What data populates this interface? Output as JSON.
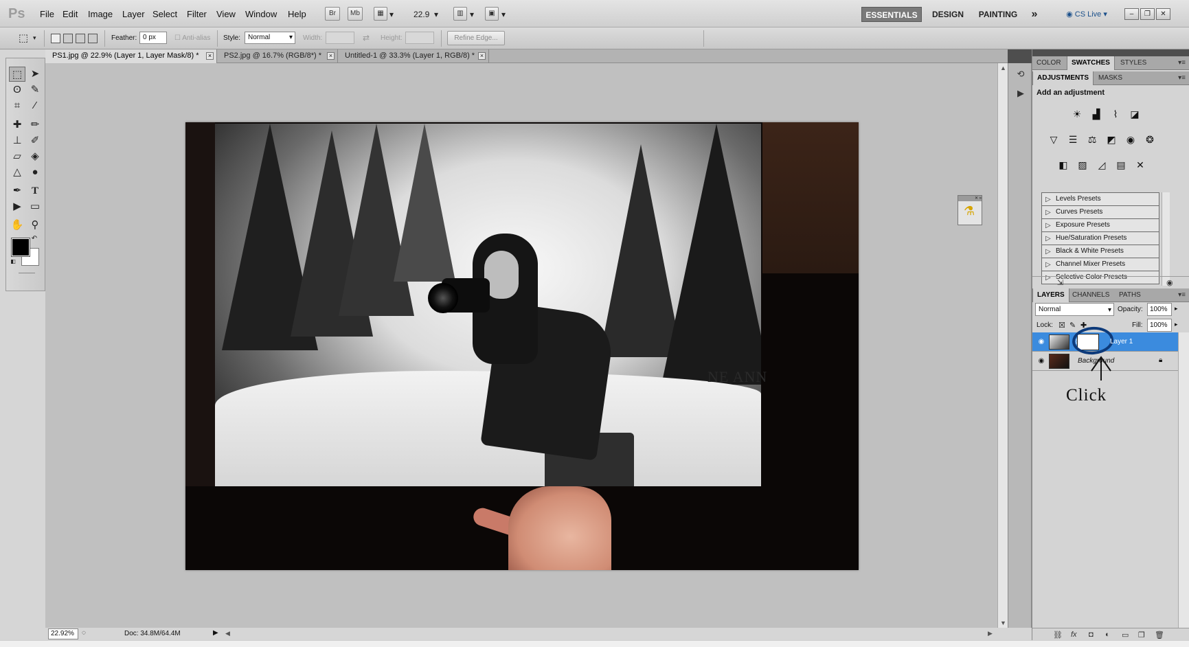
{
  "app": {
    "logo": "Ps"
  },
  "menu": [
    "File",
    "Edit",
    "Image",
    "Layer",
    "Select",
    "Filter",
    "View",
    "Window",
    "Help"
  ],
  "menubar_icons": {
    "bridge": "Br",
    "minibridge": "Mb",
    "zoom_level": "22.9"
  },
  "workspaces": {
    "essentials": "ESSENTIALS",
    "design": "DESIGN",
    "painting": "PAINTING",
    "more": "»",
    "cslive": "CS Live"
  },
  "window_controls": {
    "minimize": "▭",
    "restore": "▭",
    "close": "✕"
  },
  "options": {
    "feather_label": "Feather:",
    "feather_value": "0 px",
    "antialias_label": "Anti-alias",
    "style_label": "Style:",
    "style_value": "Normal",
    "width_label": "Width:",
    "height_label": "Height:",
    "refine_edge": "Refine Edge..."
  },
  "doc_tabs": [
    {
      "title": "PS1.jpg @ 22.9% (Layer 1, Layer Mask/8) *",
      "active": true
    },
    {
      "title": "PS2.jpg @ 16.7% (RGB/8*) *",
      "active": false
    },
    {
      "title": "Untitled-1 @ 33.3% (Layer 1, RGB/8) *",
      "active": false
    }
  ],
  "photo": {
    "watermark": "NE ANN"
  },
  "status": {
    "zoom": "22.92%",
    "doc_info": "Doc: 34.8M/64.4M"
  },
  "panel_color": {
    "tabs": [
      "COLOR",
      "SWATCHES",
      "STYLES"
    ],
    "active": "SWATCHES"
  },
  "panel_adjust": {
    "tabs": [
      "ADJUSTMENTS",
      "MASKS"
    ],
    "active": "ADJUSTMENTS",
    "title": "Add an adjustment",
    "presets": [
      "Levels Presets",
      "Curves Presets",
      "Exposure Presets",
      "Hue/Saturation Presets",
      "Black & White Presets",
      "Channel Mixer Presets",
      "Selective Color Presets"
    ]
  },
  "panel_layers": {
    "tabs": [
      "LAYERS",
      "CHANNELS",
      "PATHS"
    ],
    "active": "LAYERS",
    "blend_mode": "Normal",
    "opacity_label": "Opacity:",
    "opacity_value": "100%",
    "lock_label": "Lock:",
    "fill_label": "Fill:",
    "fill_value": "100%",
    "layers": [
      {
        "name": "Layer 1",
        "selected": true
      },
      {
        "name": "Background",
        "selected": false
      }
    ],
    "annotation": "Click"
  },
  "colors": {
    "accent": "#3b8bde",
    "annotation": "#0d3a7a",
    "chrome": "#d4d4d4"
  }
}
